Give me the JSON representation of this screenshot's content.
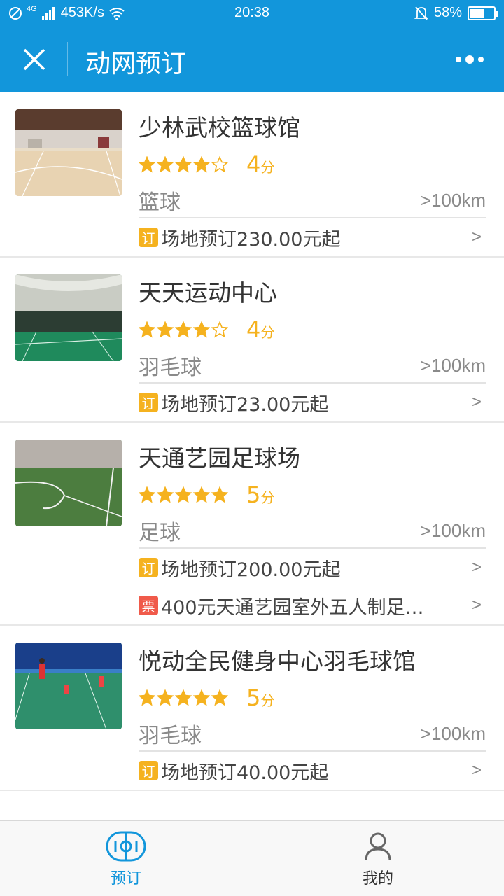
{
  "status_bar": {
    "network": "453K/s",
    "net_type": "4G",
    "time": "20:38",
    "battery_percent": "58%",
    "battery_level": 0.58
  },
  "header": {
    "title": "动网预订",
    "close_icon": "close-icon",
    "more_icon": "more-icon"
  },
  "colors": {
    "brand": "#1296db",
    "star": "#f5b21f",
    "order_badge": "#f5b21f",
    "ticket_badge": "#f05a4a"
  },
  "venues": [
    {
      "name": "少林武校篮球馆",
      "rating": 4,
      "score": "4",
      "score_unit": "分",
      "sport": "篮球",
      "distance": ">100km",
      "offers": [
        {
          "badge": "订",
          "type": "order",
          "text": "场地预订230.00元起",
          "arrow": ">"
        }
      ]
    },
    {
      "name": "天天运动中心",
      "rating": 4,
      "score": "4",
      "score_unit": "分",
      "sport": "羽毛球",
      "distance": ">100km",
      "offers": [
        {
          "badge": "订",
          "type": "order",
          "text": "场地预订23.00元起",
          "arrow": ">"
        }
      ]
    },
    {
      "name": "天通艺园足球场",
      "rating": 5,
      "score": "5",
      "score_unit": "分",
      "sport": "足球",
      "distance": ">100km",
      "offers": [
        {
          "badge": "订",
          "type": "order",
          "text": "场地预订200.00元起",
          "arrow": ">"
        },
        {
          "badge": "票",
          "type": "ticket",
          "text": "400元天通艺园室外五人制足…",
          "arrow": ">"
        }
      ]
    },
    {
      "name": "悦动全民健身中心羽毛球馆",
      "rating": 5,
      "score": "5",
      "score_unit": "分",
      "sport": "羽毛球",
      "distance": ">100km",
      "offers": [
        {
          "badge": "订",
          "type": "order",
          "text": "场地预订40.00元起",
          "arrow": ">"
        }
      ]
    }
  ],
  "tabs": [
    {
      "label": "预订",
      "icon": "venue-field-icon",
      "active": true
    },
    {
      "label": "我的",
      "icon": "user-icon",
      "active": false
    }
  ]
}
